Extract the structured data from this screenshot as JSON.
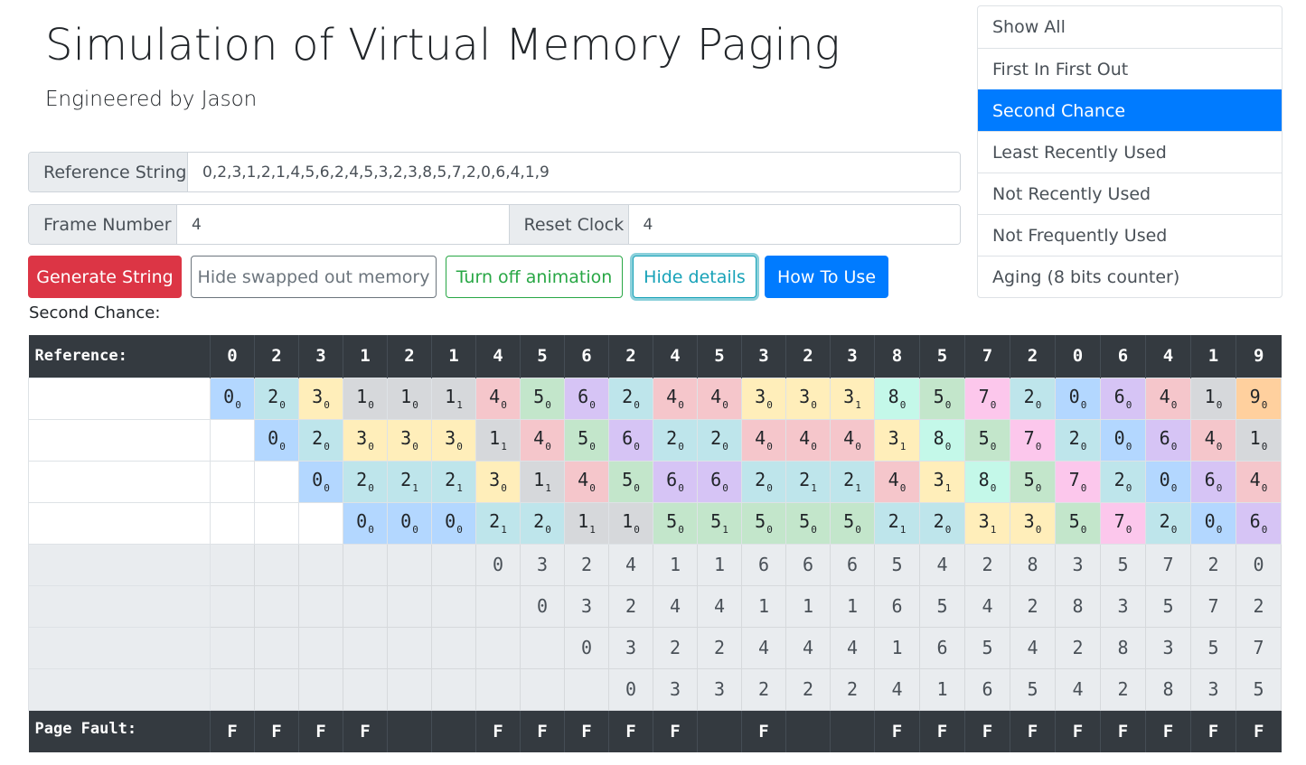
{
  "header": {
    "title": "Simulation of Virtual Memory Paging",
    "subtitle": "Engineered by Jason"
  },
  "inputs": {
    "reference_label": "Reference String",
    "reference_value": "0,2,3,1,2,1,4,5,6,2,4,5,3,2,3,8,5,7,2,0,6,4,1,9",
    "frame_label": "Frame Number",
    "frame_value": "4",
    "reset_label": "Reset Clock",
    "reset_value": "4"
  },
  "buttons": {
    "generate": "Generate String",
    "hide_swapped": "Hide swapped out memory",
    "animation": "Turn off animation",
    "hide_details": "Hide details",
    "how_to_use": "How To Use"
  },
  "algorithm_menu": [
    {
      "label": "Show All",
      "active": false
    },
    {
      "label": "First In First Out",
      "active": false
    },
    {
      "label": "Second Chance",
      "active": true
    },
    {
      "label": "Least Recently Used",
      "active": false
    },
    {
      "label": "Not Recently Used",
      "active": false
    },
    {
      "label": "Not Frequently Used",
      "active": false
    },
    {
      "label": "Aging (8 bits counter)",
      "active": false
    }
  ],
  "section_label": "Second Chance:",
  "table": {
    "reference_label": "Reference:",
    "page_fault_label": "Page Fault:",
    "references": [
      "0",
      "2",
      "3",
      "1",
      "2",
      "1",
      "4",
      "5",
      "6",
      "2",
      "4",
      "5",
      "3",
      "2",
      "3",
      "8",
      "5",
      "7",
      "2",
      "0",
      "6",
      "4",
      "1",
      "9"
    ],
    "page_colors": {
      "0": "#b3d7ff",
      "1": "#d6d8db",
      "2": "#bee5eb",
      "3": "#ffeeba",
      "4": "#f5c6cb",
      "5": "#c3e6cb",
      "6": "#d6c4f5",
      "7": "#fcc7ec",
      "8": "#c4f8e9",
      "9": "#ffd09e"
    },
    "frames": [
      [
        [
          "0",
          "0"
        ],
        [
          "2",
          "0"
        ],
        [
          "3",
          "0"
        ],
        [
          "1",
          "0"
        ],
        [
          "1",
          "0"
        ],
        [
          "1",
          "1"
        ],
        [
          "4",
          "0"
        ],
        [
          "5",
          "0"
        ],
        [
          "6",
          "0"
        ],
        [
          "2",
          "0"
        ],
        [
          "4",
          "0"
        ],
        [
          "4",
          "0"
        ],
        [
          "3",
          "0"
        ],
        [
          "3",
          "0"
        ],
        [
          "3",
          "1"
        ],
        [
          "8",
          "0"
        ],
        [
          "5",
          "0"
        ],
        [
          "7",
          "0"
        ],
        [
          "2",
          "0"
        ],
        [
          "0",
          "0"
        ],
        [
          "6",
          "0"
        ],
        [
          "4",
          "0"
        ],
        [
          "1",
          "0"
        ],
        [
          "9",
          "0"
        ]
      ],
      [
        null,
        [
          "0",
          "0"
        ],
        [
          "2",
          "0"
        ],
        [
          "3",
          "0"
        ],
        [
          "3",
          "0"
        ],
        [
          "3",
          "0"
        ],
        [
          "1",
          "1"
        ],
        [
          "4",
          "0"
        ],
        [
          "5",
          "0"
        ],
        [
          "6",
          "0"
        ],
        [
          "2",
          "0"
        ],
        [
          "2",
          "0"
        ],
        [
          "4",
          "0"
        ],
        [
          "4",
          "0"
        ],
        [
          "4",
          "0"
        ],
        [
          "3",
          "1"
        ],
        [
          "8",
          "0"
        ],
        [
          "5",
          "0"
        ],
        [
          "7",
          "0"
        ],
        [
          "2",
          "0"
        ],
        [
          "0",
          "0"
        ],
        [
          "6",
          "0"
        ],
        [
          "4",
          "0"
        ],
        [
          "1",
          "0"
        ]
      ],
      [
        null,
        null,
        [
          "0",
          "0"
        ],
        [
          "2",
          "0"
        ],
        [
          "2",
          "1"
        ],
        [
          "2",
          "1"
        ],
        [
          "3",
          "0"
        ],
        [
          "1",
          "1"
        ],
        [
          "4",
          "0"
        ],
        [
          "5",
          "0"
        ],
        [
          "6",
          "0"
        ],
        [
          "6",
          "0"
        ],
        [
          "2",
          "0"
        ],
        [
          "2",
          "1"
        ],
        [
          "2",
          "1"
        ],
        [
          "4",
          "0"
        ],
        [
          "3",
          "1"
        ],
        [
          "8",
          "0"
        ],
        [
          "5",
          "0"
        ],
        [
          "7",
          "0"
        ],
        [
          "2",
          "0"
        ],
        [
          "0",
          "0"
        ],
        [
          "6",
          "0"
        ],
        [
          "4",
          "0"
        ]
      ],
      [
        null,
        null,
        null,
        [
          "0",
          "0"
        ],
        [
          "0",
          "0"
        ],
        [
          "0",
          "0"
        ],
        [
          "2",
          "1"
        ],
        [
          "2",
          "0"
        ],
        [
          "1",
          "1"
        ],
        [
          "1",
          "0"
        ],
        [
          "5",
          "0"
        ],
        [
          "5",
          "1"
        ],
        [
          "5",
          "0"
        ],
        [
          "5",
          "0"
        ],
        [
          "5",
          "0"
        ],
        [
          "2",
          "1"
        ],
        [
          "2",
          "0"
        ],
        [
          "3",
          "1"
        ],
        [
          "3",
          "0"
        ],
        [
          "5",
          "0"
        ],
        [
          "7",
          "0"
        ],
        [
          "2",
          "0"
        ],
        [
          "0",
          "0"
        ],
        [
          "6",
          "0"
        ]
      ]
    ],
    "swapped": [
      [
        "",
        "",
        "",
        "",
        "",
        "",
        "0",
        "3",
        "2",
        "4",
        "1",
        "1",
        "6",
        "6",
        "6",
        "5",
        "4",
        "2",
        "8",
        "3",
        "5",
        "7",
        "2",
        "0"
      ],
      [
        "",
        "",
        "",
        "",
        "",
        "",
        "",
        "0",
        "3",
        "2",
        "4",
        "4",
        "1",
        "1",
        "1",
        "6",
        "5",
        "4",
        "2",
        "8",
        "3",
        "5",
        "7",
        "2"
      ],
      [
        "",
        "",
        "",
        "",
        "",
        "",
        "",
        "",
        "0",
        "3",
        "2",
        "2",
        "4",
        "4",
        "4",
        "1",
        "6",
        "5",
        "4",
        "2",
        "8",
        "3",
        "5",
        "7"
      ],
      [
        "",
        "",
        "",
        "",
        "",
        "",
        "",
        "",
        "",
        "0",
        "3",
        "3",
        "2",
        "2",
        "2",
        "4",
        "1",
        "6",
        "5",
        "4",
        "2",
        "8",
        "3",
        "5"
      ]
    ],
    "faults": [
      "F",
      "F",
      "F",
      "F",
      "",
      "",
      "F",
      "F",
      "F",
      "F",
      "F",
      "",
      "F",
      "",
      "",
      "F",
      "F",
      "F",
      "F",
      "F",
      "F",
      "F",
      "F",
      "F"
    ]
  }
}
